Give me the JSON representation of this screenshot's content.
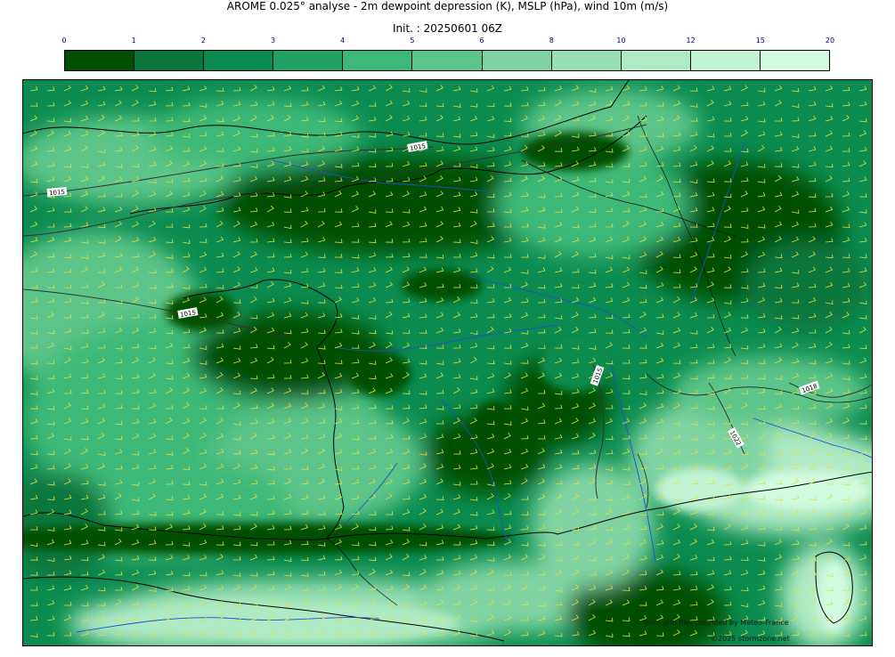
{
  "header": {
    "title": "AROME 0.025° analyse - 2m dewpoint depression (K), MSLP (hPa), wind 10m (m/s)",
    "init": "Init. : 20250601 06Z"
  },
  "colorbar": {
    "ticks": [
      "0",
      "1",
      "2",
      "3",
      "4",
      "5",
      "6",
      "8",
      "10",
      "12",
      "15",
      "20"
    ],
    "colors": [
      "#005000",
      "#0b763c",
      "#0b8b50",
      "#23a064",
      "#3cb878",
      "#5dc58a",
      "#7fd3a2",
      "#96e0b4",
      "#aeebc5",
      "#bff3d2",
      "#d2fbe0"
    ]
  },
  "map": {
    "isobar_labels": [
      "1015",
      "1015",
      "1015",
      "1015",
      "1018",
      "1022",
      "1022"
    ],
    "credits": {
      "line1": "from grib files provided by Meteo-France",
      "line2": "©2025 stormzone.net"
    }
  }
}
